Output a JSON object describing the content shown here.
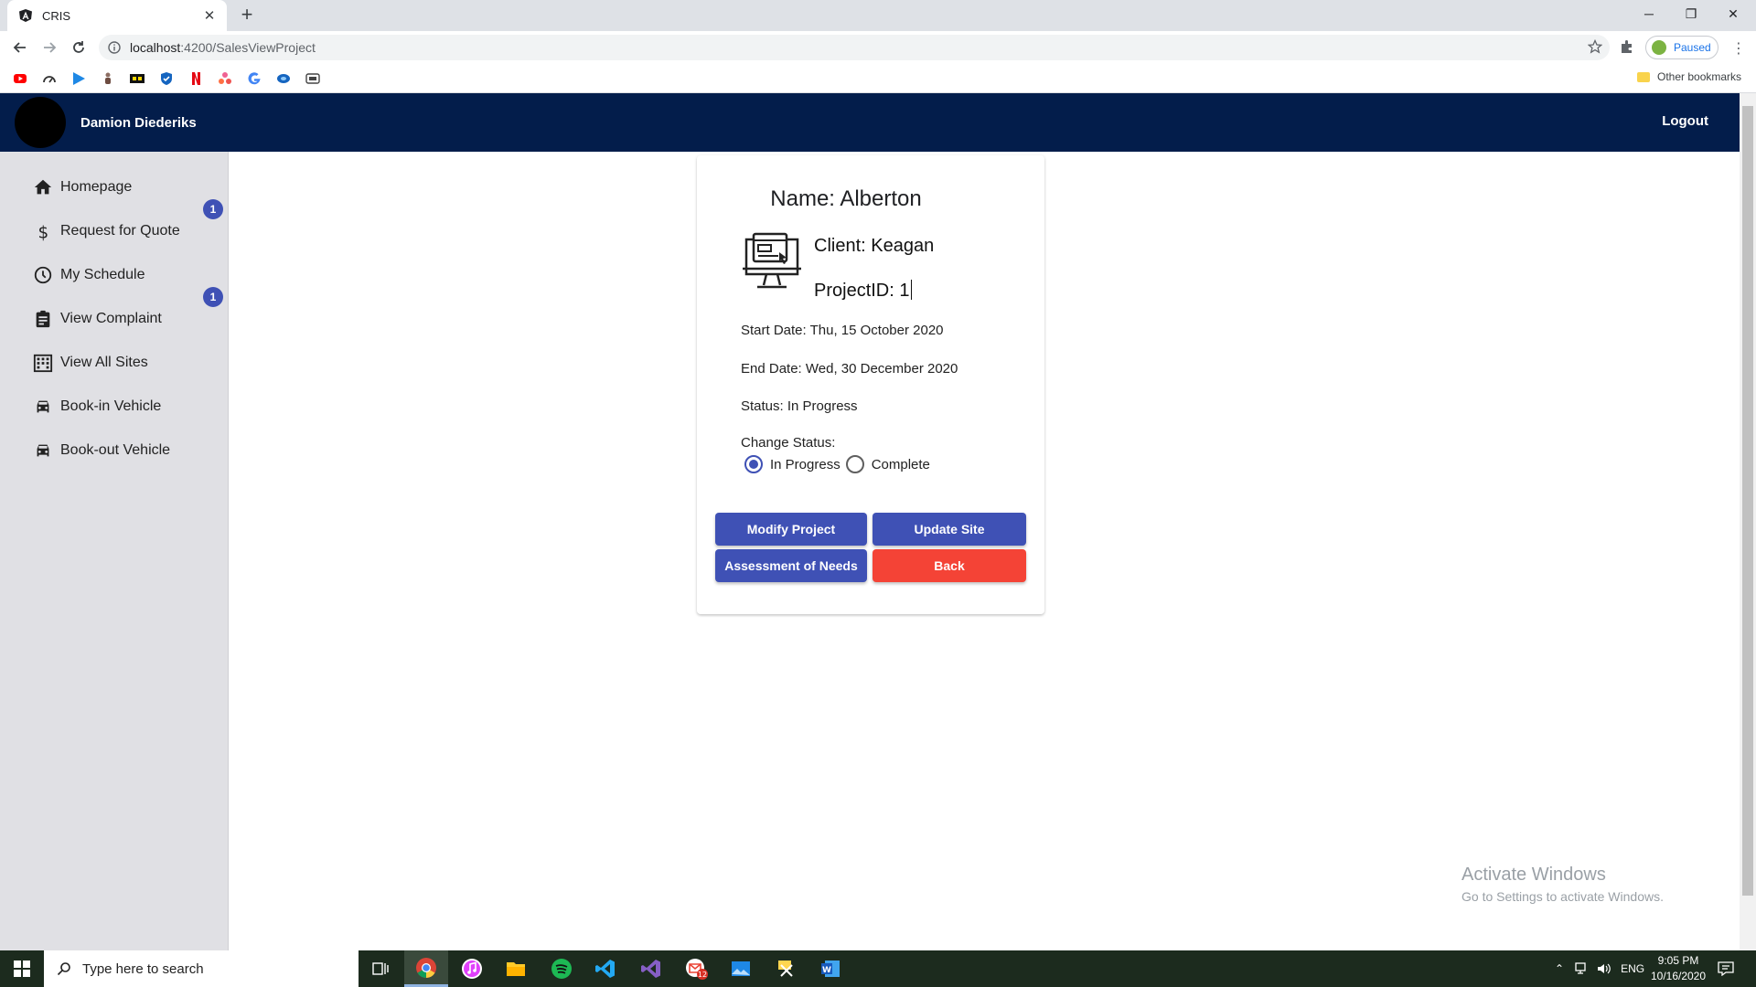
{
  "browser": {
    "tab_title": "CRIS",
    "url_host": "localhost",
    "url_path": ":4200/SalesViewProject",
    "profile_status": "Paused",
    "other_bookmarks": "Other bookmarks",
    "bookmark_icons": [
      "youtube-icon",
      "speedometer-icon",
      "play-icon",
      "figure-icon",
      "bb-icon",
      "shield-icon",
      "netflix-icon",
      "dots-icon",
      "google-icon",
      "disc-icon",
      "csr-icon"
    ]
  },
  "header": {
    "user_name": "Damion Diederiks",
    "logout_label": "Logout"
  },
  "sidebar": {
    "items": [
      {
        "label": "Homepage",
        "icon": "home-icon"
      },
      {
        "label": "Request for Quote",
        "icon": "dollar-icon"
      },
      {
        "label": "My Schedule",
        "icon": "clock-icon"
      },
      {
        "label": "View Complaint",
        "icon": "clipboard-icon"
      },
      {
        "label": "View All Sites",
        "icon": "building-icon"
      },
      {
        "label": "Book-in Vehicle",
        "icon": "car-icon"
      },
      {
        "label": "Book-out Vehicle",
        "icon": "car-icon"
      }
    ],
    "badges": [
      "1",
      "1"
    ]
  },
  "project": {
    "name": "Name: Alberton",
    "client": "Client: Keagan",
    "project_id": "ProjectID: 1",
    "start_date": "Start Date: Thu, 15 October 2020",
    "end_date": "End Date: Wed, 30 December 2020",
    "status": "Status: In Progress",
    "change_status_label": "Change Status:",
    "status_options": [
      {
        "label": "In Progress",
        "selected": true
      },
      {
        "label": "Complete",
        "selected": false
      }
    ]
  },
  "actions": {
    "modify_project": "Modify Project",
    "update_site": "Update Site",
    "assessment_of_needs": "Assessment of Needs",
    "back": "Back"
  },
  "colors": {
    "header_bg": "#031d4b",
    "primary": "#3f51b5",
    "warn": "#f44336",
    "sidebar_bg": "#e0e0e4"
  },
  "watermark": {
    "line1": "Activate Windows",
    "line2": "Go to Settings to activate Windows."
  },
  "taskbar": {
    "search_placeholder": "Type here to search",
    "language": "ENG",
    "time": "9:05 PM",
    "date": "10/16/2020",
    "apps": [
      "task-view-icon",
      "chrome-icon",
      "itunes-icon",
      "file-explorer-icon",
      "spotify-icon",
      "vscode-icon",
      "visual-studio-icon",
      "gmail-icon",
      "photos-icon",
      "tools-icon",
      "word-icon"
    ],
    "mail_badge": "12"
  }
}
